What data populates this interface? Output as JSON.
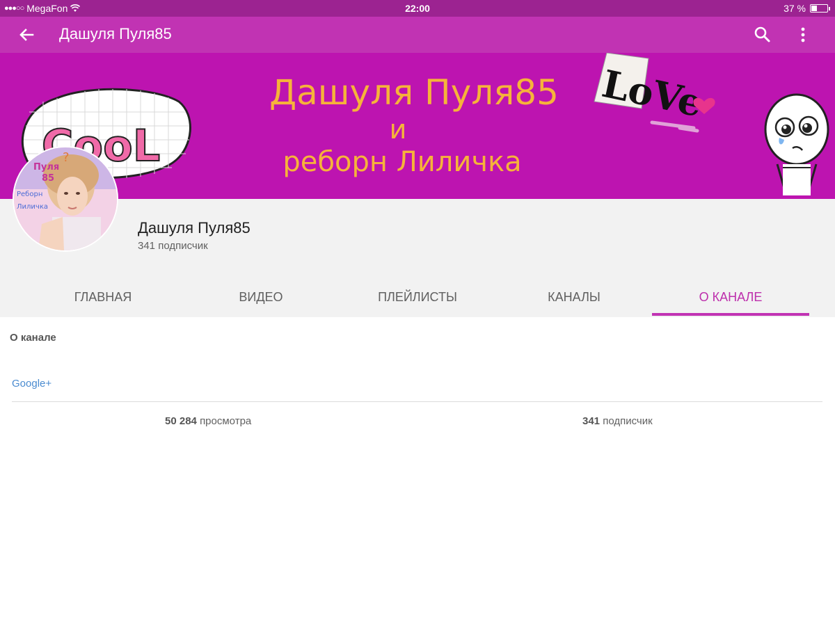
{
  "status_bar": {
    "signal_dots": "●●●○○",
    "carrier": "MegaFon",
    "time": "22:00",
    "battery_text": "37 %",
    "battery_level": 0.37
  },
  "app_bar": {
    "title": "Дашуля Пуля85",
    "icons": [
      "arrow-back-icon",
      "search-icon",
      "more-vert-icon"
    ]
  },
  "banner": {
    "line1": "Дашуля Пуля85",
    "line2": "и",
    "line3": "реборн Лиличка",
    "sticker_cool": "CooL",
    "sticker_love": "LoVe",
    "avatar_overlay": [
      "Пуля",
      "85",
      "Реборн",
      "Лиличка"
    ]
  },
  "channel": {
    "name": "Дашуля Пуля85",
    "subscribers": "341 подписчик"
  },
  "tabs": [
    {
      "label": "ГЛАВНАЯ",
      "active": false
    },
    {
      "label": "ВИДЕО",
      "active": false
    },
    {
      "label": "ПЛЕЙЛИСТЫ",
      "active": false
    },
    {
      "label": "КАНАЛЫ",
      "active": false
    },
    {
      "label": "О КАНАЛЕ",
      "active": true
    }
  ],
  "about": {
    "heading": "О канале",
    "link": "Google+",
    "views_count": "50 284",
    "views_label": "просмотра",
    "subs_count": "341",
    "subs_label": "подписчик"
  },
  "colors": {
    "status_bar": "#9c2391",
    "app_bar": "#c133b3",
    "banner": "#bd14b0",
    "banner_text": "#f6b33a",
    "accent": "#bd2fac",
    "link": "#4a8bd0"
  }
}
